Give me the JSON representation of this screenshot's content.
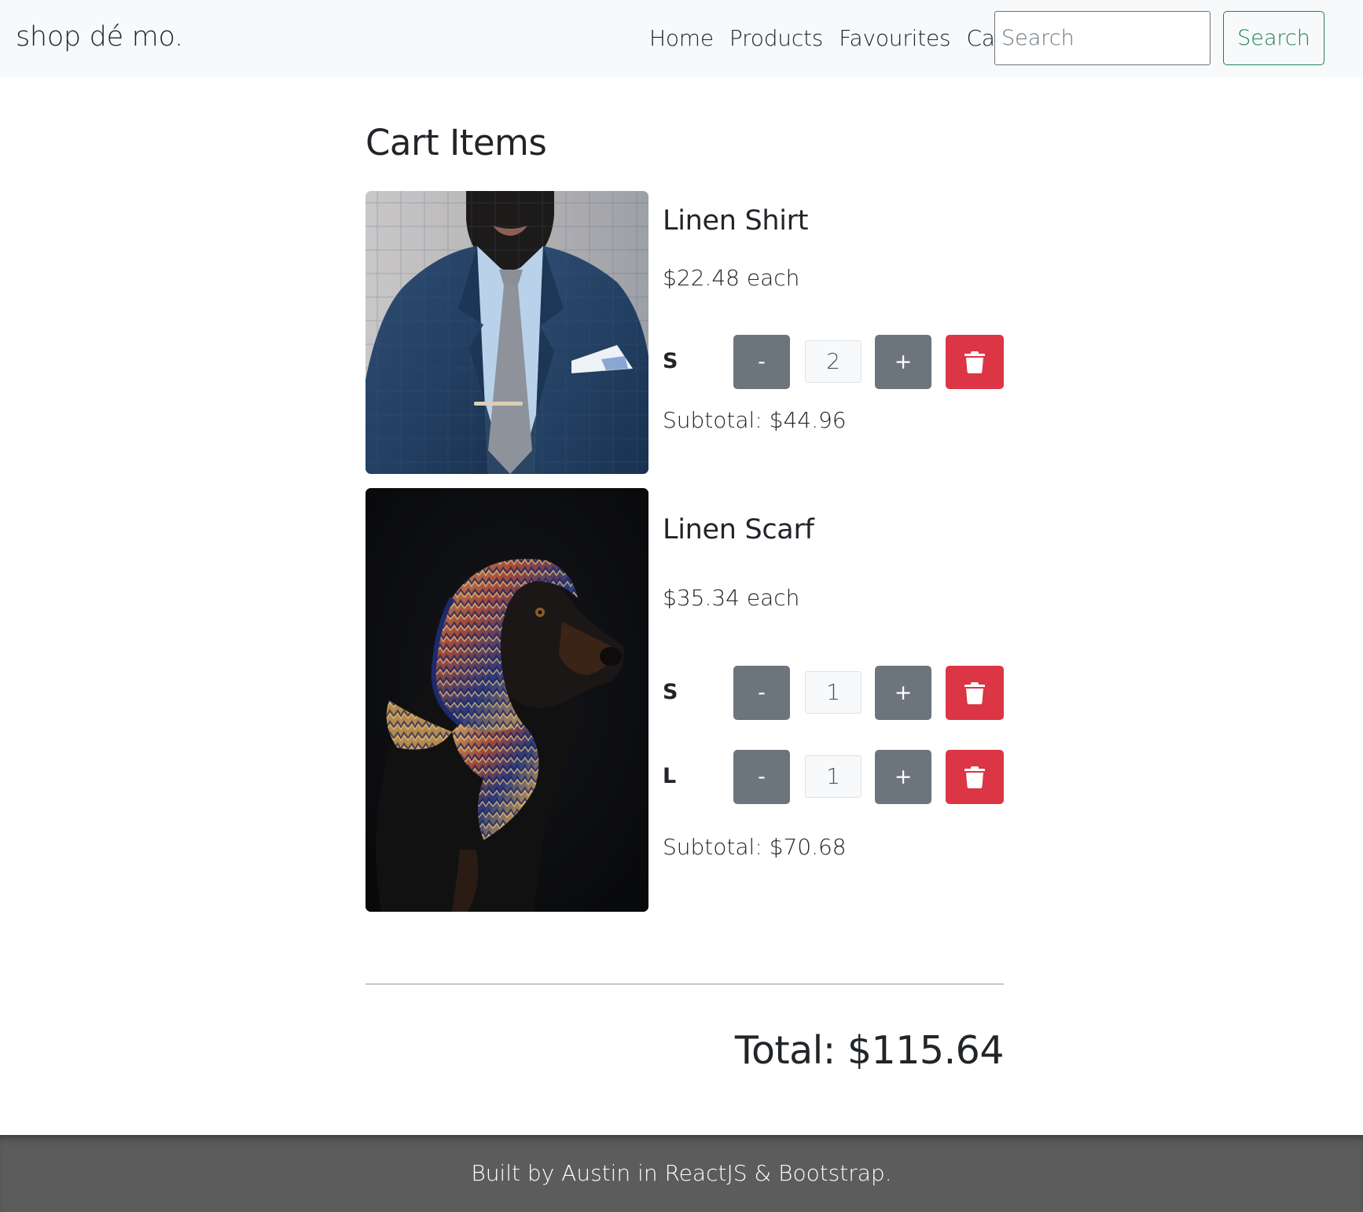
{
  "navbar": {
    "brand": "shop dé mo.",
    "links": [
      "Home",
      "Products",
      "Favourites",
      "Cart"
    ],
    "search_placeholder": "Search",
    "search_button": "Search"
  },
  "page_title": "Cart Items",
  "items": [
    {
      "name": "Linen Shirt",
      "price": "$22.48 each",
      "image": "man in blue suit with grey tie",
      "sizes": [
        {
          "size": "S",
          "minus": "-",
          "quantity": "2",
          "plus": "+"
        }
      ],
      "subtotal": "Subtotal: $44.96"
    },
    {
      "name": "Linen Scarf",
      "price": "$35.34 each",
      "image": "dog wearing patterned scarf",
      "sizes": [
        {
          "size": "S",
          "minus": "-",
          "quantity": "1",
          "plus": "+"
        },
        {
          "size": "L",
          "minus": "-",
          "quantity": "1",
          "plus": "+"
        }
      ],
      "subtotal": "Subtotal: $70.68"
    }
  ],
  "total": "Total: $115.64",
  "footer": "Built by Austin in ReactJS & Bootstrap.",
  "icons": {
    "delete": "trash-icon"
  },
  "colors": {
    "success": "#198754",
    "secondary": "#6c757d",
    "danger": "#dc3545",
    "navbar_bg": "#f8f9fa",
    "footer_bg": "#5c5c5c"
  }
}
